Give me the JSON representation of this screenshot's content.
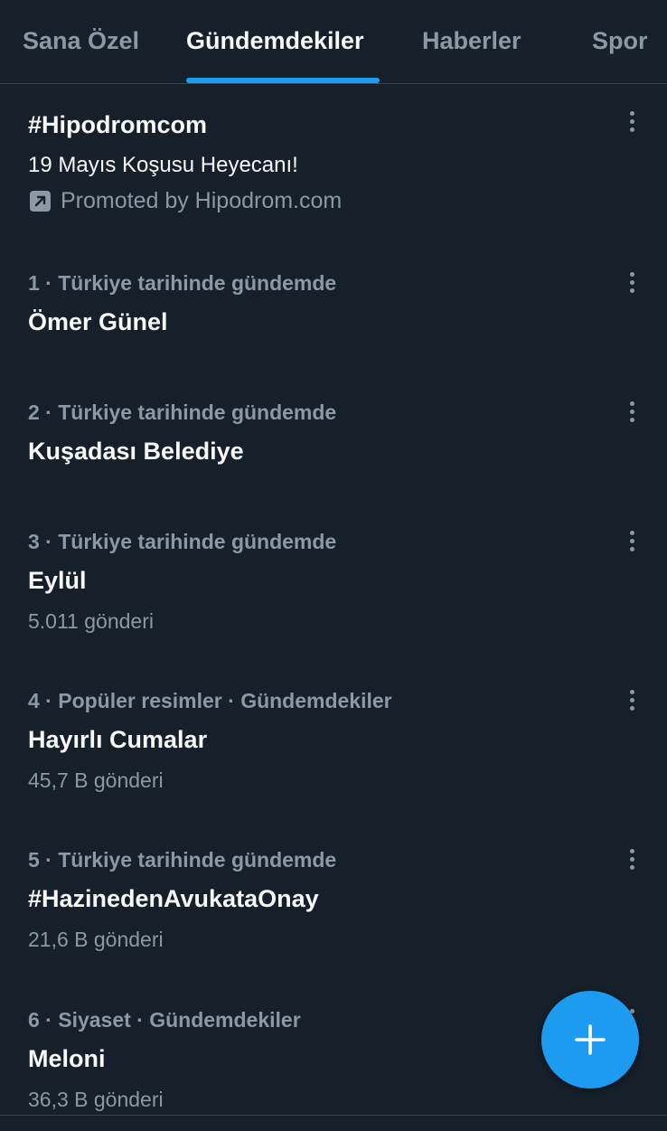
{
  "tabs": [
    {
      "label": "Sana Özel"
    },
    {
      "label": "Gündemdekiler",
      "active": true
    },
    {
      "label": "Haberler"
    },
    {
      "label": "Spor"
    }
  ],
  "promoted": {
    "title": "#Hipodromcom",
    "subtitle": "19 Mayıs Koşusu Heyecanı!",
    "promoted_by": "Promoted by Hipodrom.com",
    "icon": "promoted-arrow-icon"
  },
  "trends": [
    {
      "meta": "1 · Türkiye tarihinde gündemde",
      "title": "Ömer Günel",
      "count": ""
    },
    {
      "meta": "2 · Türkiye tarihinde gündemde",
      "title": "Kuşadası Belediye",
      "count": ""
    },
    {
      "meta": "3 · Türkiye tarihinde gündemde",
      "title": "Eylül",
      "count": "5.011 gönderi"
    },
    {
      "meta": "4 · Popüler resimler · Gündemdekiler",
      "title": "Hayırlı Cumalar",
      "count": "45,7 B gönderi"
    },
    {
      "meta": "5 · Türkiye tarihinde gündemde",
      "title": "#HazinedenAvukataOnay",
      "count": "21,6 B gönderi"
    },
    {
      "meta": "6 · Siyaset · Gündemdekiler",
      "title": "Meloni",
      "count": "36,3 B gönderi"
    }
  ],
  "fab": {
    "icon": "plus-icon"
  },
  "colors": {
    "background": "#15202b",
    "accent": "#1d9bf0",
    "text_primary": "#f7f9f9",
    "text_secondary": "#8b98a5",
    "divider": "#38444d"
  }
}
